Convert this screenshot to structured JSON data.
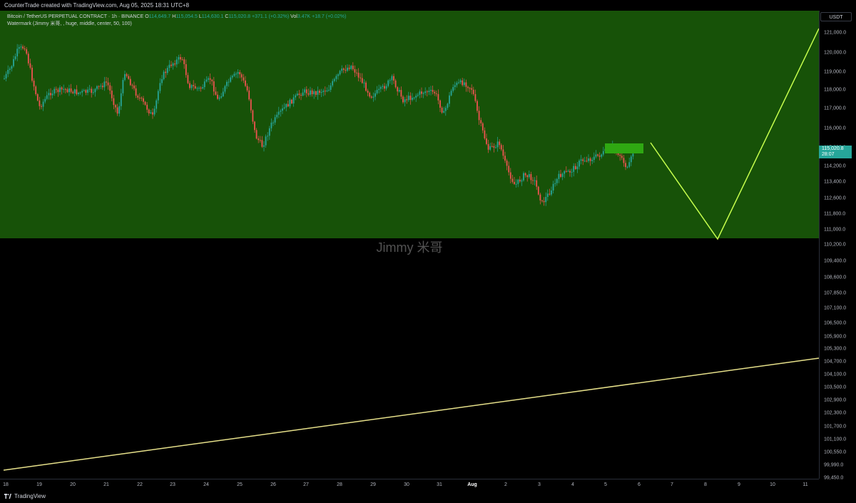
{
  "header": {
    "title": "CounterTrade created with TradingView.com, Aug 05, 2025 18:31 UTC+8"
  },
  "legend": {
    "symbol": "Bitcoin / TetherUS PERPETUAL CONTRACT · 1h · BINANCE",
    "o_label": "O",
    "o": "114,649.7",
    "h_label": "H",
    "h": "115,054.5",
    "l_label": "L",
    "l": "114,630.1",
    "c_label": "C",
    "c": "115,020.8",
    "change": "+371.1 (+0.32%)",
    "vol_label": "Vol",
    "vol": "3.47K",
    "vol_change": "+18.7 (+0.02%)",
    "indicator": "Watermark (Jimmy 米哥, , huge, middle, center, 50, 100)"
  },
  "watermark": "Jimmy 米哥",
  "price_axis": {
    "currency": "USDT",
    "ticks": [
      "121,000.0",
      "120,000.0",
      "119,000.0",
      "118,000.0",
      "117,000.0",
      "116,000.0",
      "115,000.0",
      "114,200.0",
      "113,400.0",
      "112,600.0",
      "111,800.0",
      "111,000.0",
      "110,200.0",
      "109,400.0",
      "108,600.0",
      "107,850.0",
      "107,100.0",
      "106,500.0",
      "105,900.0",
      "105,300.0",
      "104,700.0",
      "104,100.0",
      "103,500.0",
      "102,900.0",
      "102,300.0",
      "101,700.0",
      "101,100.0",
      "100,550.0",
      "99,990.0",
      "99,450.0"
    ],
    "last_price": "115,020.8",
    "countdown": "28:07"
  },
  "time_axis": {
    "ticks": [
      "18",
      "19",
      "20",
      "21",
      "22",
      "23",
      "24",
      "25",
      "26",
      "27",
      "28",
      "29",
      "30",
      "31",
      "Aug",
      "2",
      "3",
      "4",
      "5",
      "6",
      "7",
      "8",
      "9",
      "10",
      "11"
    ]
  },
  "footer": {
    "brand": "TradingView"
  },
  "colors": {
    "zone": "#175208",
    "up": "#26a69a",
    "down": "#ef5350",
    "projection": "#c6ff4d",
    "trendline": "#e6e08a"
  }
}
